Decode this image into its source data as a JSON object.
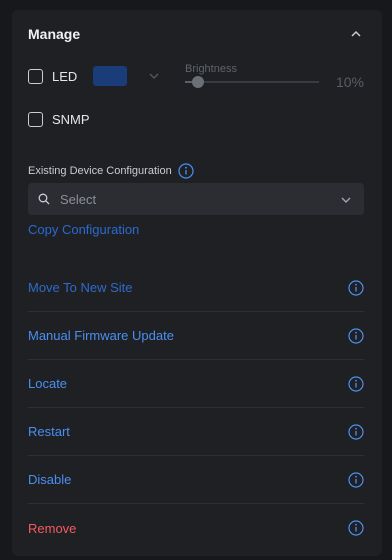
{
  "header": {
    "title": "Manage",
    "collapse_icon": "chevron-up-icon"
  },
  "led": {
    "label": "LED",
    "checked": false,
    "swatch_color": "#1a3c78"
  },
  "brightness": {
    "label": "Brightness",
    "value_text": "10%",
    "value": 10
  },
  "snmp": {
    "label": "SNMP",
    "checked": false
  },
  "config": {
    "label": "Existing Device Configuration",
    "select_placeholder": "Select",
    "copy_label": "Copy Configuration"
  },
  "actions": [
    {
      "label": "Move To New Site",
      "style": "dim"
    },
    {
      "label": "Manual Firmware Update",
      "style": "normal"
    },
    {
      "label": "Locate",
      "style": "normal"
    },
    {
      "label": "Restart",
      "style": "normal"
    },
    {
      "label": "Disable",
      "style": "normal"
    },
    {
      "label": "Remove",
      "style": "danger"
    }
  ],
  "colors": {
    "accent": "#4a8ff0",
    "danger": "#f25b5e",
    "panel": "#1f2024"
  }
}
